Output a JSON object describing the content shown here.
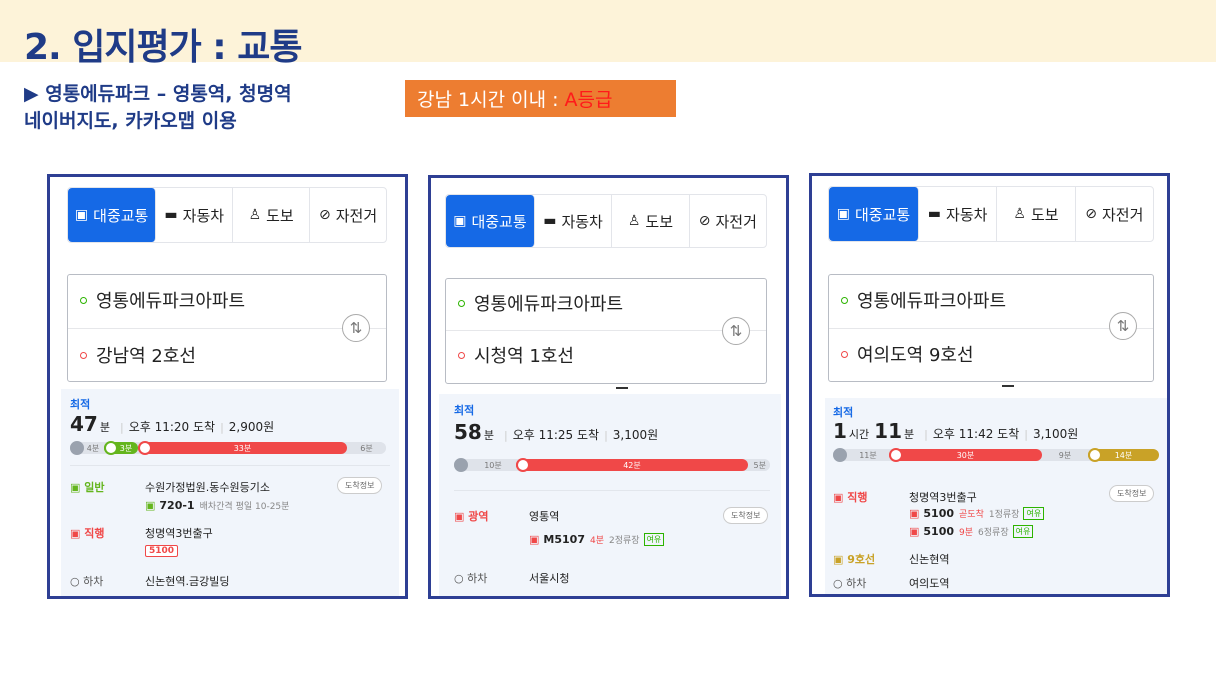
{
  "page": {
    "title": "2. 입지평가 : 교통",
    "subtitle_line1": "▶ 영통에듀파크 – 영통역, 청명역",
    "subtitle_line2": "네이버지도, 카카오맵 이용",
    "grade_prefix": "강남 1시간 이내 : ",
    "grade_value": "A등급"
  },
  "tabs": {
    "transit": "대중교통",
    "car": "자동차",
    "walk": "도보",
    "bike": "자전거"
  },
  "colors": {
    "accent_blue": "#1569e6",
    "title_navy": "#1f3b87",
    "bus_red": "#f04848",
    "bus_green": "#64b51d",
    "line9_gold": "#c9a227",
    "grade_box": "#ed7d31"
  },
  "icons": {
    "transit": "bus-icon",
    "car": "car-icon",
    "walk": "walk-icon",
    "bike": "bicycle-icon",
    "swap": "swap-arrows-icon"
  },
  "panels": [
    {
      "origin": "영통에듀파크아파트",
      "destination": "강남역 2호선",
      "best_label": "최적",
      "time_big": "47",
      "time_unit": "분",
      "arrive": "오후 11:20 도착",
      "fare": "2,900원",
      "segments": [
        {
          "label": "4분",
          "minutes": 4,
          "kind": "walk"
        },
        {
          "label": "3분",
          "minutes": 3,
          "kind": "green-bus"
        },
        {
          "label": "33분",
          "minutes": 33,
          "kind": "red-bus"
        },
        {
          "label": "6분",
          "minutes": 6,
          "kind": "walk"
        }
      ],
      "steps": {
        "s1_type": "일반",
        "s1_stop": "수원가정법원.동수원등기소",
        "s1_bus": "720-1",
        "s1_info": "배차간격 평일 10-25분",
        "s1_button": "도착정보",
        "s2_type": "직행",
        "s2_stop": "청명역3번출구",
        "s2_bus": "5100",
        "s3_type": "하차",
        "s3_stop": "신논현역.금강빌딩"
      }
    },
    {
      "origin": "영통에듀파크아파트",
      "destination": "시청역 1호선",
      "best_label": "최적",
      "time_big": "58",
      "time_unit": "분",
      "arrive": "오후 11:25 도착",
      "fare": "3,100원",
      "segments": [
        {
          "label": "10분",
          "minutes": 10,
          "kind": "walk"
        },
        {
          "label": "42분",
          "minutes": 42,
          "kind": "red-bus"
        },
        {
          "label": "5분",
          "minutes": 5,
          "kind": "walk"
        }
      ],
      "steps": {
        "s1_type": "광역",
        "s1_stop": "영통역",
        "s1_bus": "M5107",
        "s1_arrival": "4분",
        "s1_stops": "2정류장",
        "s1_seat": "여유",
        "s1_button": "도착정보",
        "s2_type": "하차",
        "s2_stop": "서울시청"
      }
    },
    {
      "origin": "영통에듀파크아파트",
      "destination": "여의도역 9호선",
      "best_label": "최적",
      "time_big1": "1",
      "time_unit1": "시간",
      "time_big2": "11",
      "time_unit2": "분",
      "arrive": "오후 11:42 도착",
      "fare": "3,100원",
      "segments": [
        {
          "label": "11분",
          "minutes": 11,
          "kind": "walk"
        },
        {
          "label": "30분",
          "minutes": 30,
          "kind": "red-bus"
        },
        {
          "label": "9분",
          "minutes": 9,
          "kind": "walk"
        },
        {
          "label": "14분",
          "minutes": 14,
          "kind": "subway-9"
        }
      ],
      "steps": {
        "s1_type": "직행",
        "s1_stop": "청명역3번출구",
        "s1_button": "도착정보",
        "bus_a": "5100",
        "bus_a_arrival": "곧도착",
        "bus_a_stops": "1정류장",
        "bus_a_seat": "여유",
        "bus_b": "5100",
        "bus_b_arrival": "9분",
        "bus_b_stops": "6정류장",
        "bus_b_seat": "여유",
        "s2_type": "9호선",
        "s2_stop": "신논현역",
        "s3_type": "하차",
        "s3_stop": "여의도역"
      }
    }
  ]
}
